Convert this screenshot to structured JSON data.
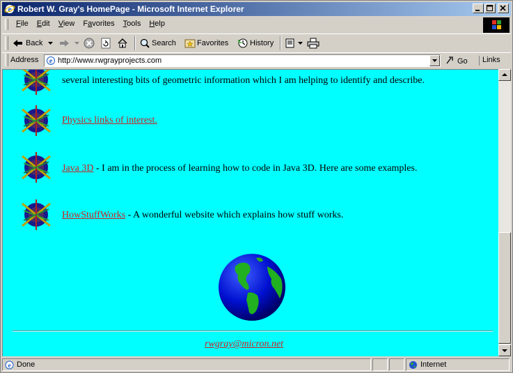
{
  "window": {
    "title": "Robert W. Gray's HomePage - Microsoft Internet Explorer",
    "buttons": [
      "_",
      "□",
      "×"
    ]
  },
  "menu": {
    "items": [
      {
        "label": "File",
        "key": "F",
        "rest": "ile"
      },
      {
        "label": "Edit",
        "key": "E",
        "rest": "dit"
      },
      {
        "label": "View",
        "key": "V",
        "rest": "iew"
      },
      {
        "label": "Favorites",
        "key": "a",
        "rest": "Favorites"
      },
      {
        "label": "Tools",
        "key": "T",
        "rest": "ools"
      },
      {
        "label": "Help",
        "key": "H",
        "rest": "elp"
      }
    ]
  },
  "toolbar": {
    "back": "Back",
    "search": "Search",
    "favorites": "Favorites",
    "history": "History"
  },
  "address": {
    "label": "Address",
    "url": "http://www.rwgrayprojects.com",
    "go": "Go",
    "links": "Links"
  },
  "page": {
    "items": [
      {
        "link": "",
        "text": "several interesting bits of geometric information which I am helping to identify and describe."
      },
      {
        "link": "Physics links of interest.",
        "text": ""
      },
      {
        "link": "Java 3D",
        "text": " - I am in the process of learning how to code in Java 3D. Here are some examples."
      },
      {
        "link": "HowStuffWorks",
        "text": " - A wonderful website which explains how stuff works."
      }
    ],
    "email": "rwgray@micron.net"
  },
  "status": {
    "text": "Done",
    "zone": "Internet"
  },
  "colors": {
    "page_background": "#00ffff",
    "link": "#cc2222",
    "titlebar_start": "#0a246a",
    "titlebar_end": "#a6caf0"
  }
}
